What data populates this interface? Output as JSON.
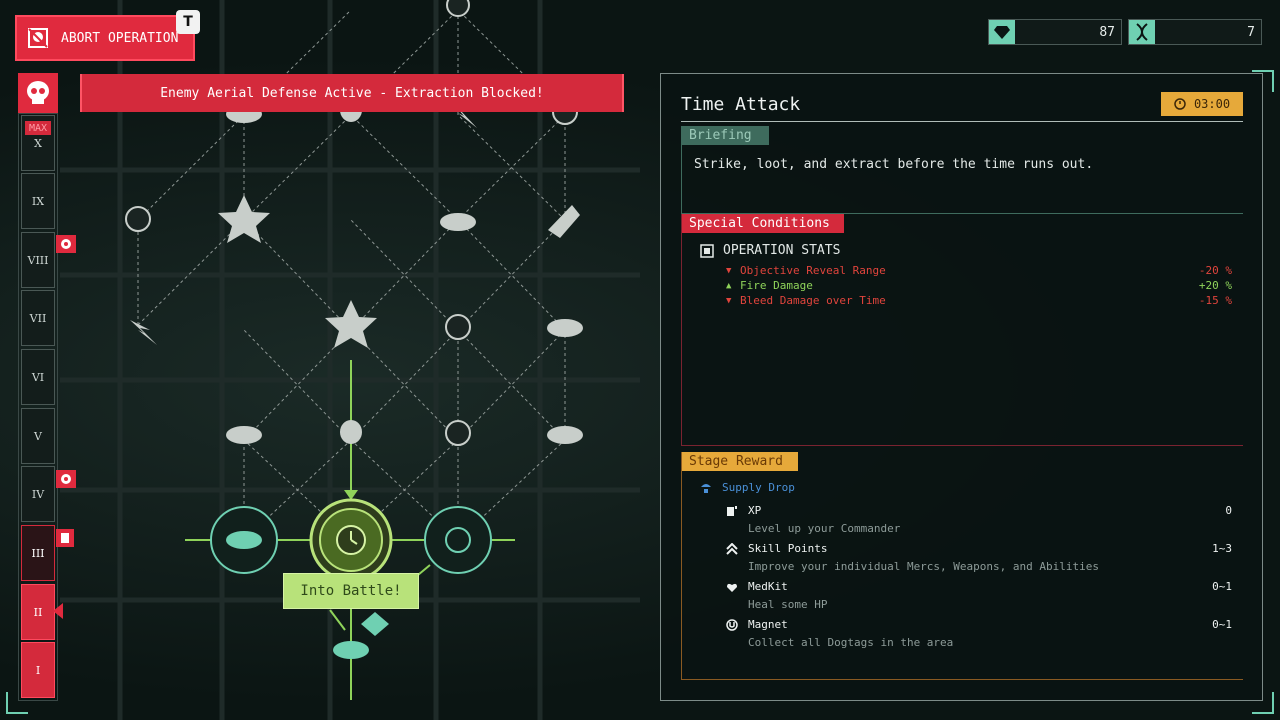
{
  "hud": {
    "abort_label": "ABORT OPERATION",
    "abort_hotkey": "T",
    "gems": "87",
    "dna": "7"
  },
  "banner": "Enemy Aerial Defense Active - Extraction Blocked!",
  "levels": {
    "max_tag": "MAX",
    "labels": [
      "X",
      "IX",
      "VIII",
      "VII",
      "VI",
      "V",
      "IV",
      "III",
      "II",
      "I"
    ],
    "current": "II"
  },
  "map": {
    "into_battle": "Into Battle!"
  },
  "panel": {
    "title": "Time Attack",
    "timer": "03:00",
    "briefing_tag": "Briefing",
    "briefing_text": "Strike, loot, and extract before the time runs out.",
    "special_tag": "Special Conditions",
    "opstats_title": "OPERATION STATS",
    "stats": [
      {
        "dir": "down",
        "label": "Objective Reveal Range",
        "value": "-20 %",
        "color": "#e0443c"
      },
      {
        "dir": "up",
        "label": "Fire Damage",
        "value": "+20 %",
        "color": "#8fd35a"
      },
      {
        "dir": "down",
        "label": "Bleed Damage over Time",
        "value": "-15 %",
        "color": "#e0443c"
      }
    ],
    "reward_tag": "Stage Reward",
    "supply_label": "Supply Drop",
    "rewards": [
      {
        "name": "XP",
        "value": "0",
        "desc": "Level up your Commander",
        "icon": "xp-icon"
      },
      {
        "name": "Skill Points",
        "value": "1~3",
        "desc": "Improve your individual Mercs, Weapons, and Abilities",
        "icon": "skill-points-icon"
      },
      {
        "name": "MedKit",
        "value": "0~1",
        "desc": "Heal some HP",
        "icon": "medkit-icon"
      },
      {
        "name": "Magnet",
        "value": "0~1",
        "desc": "Collect all Dogtags in the area",
        "icon": "magnet-icon"
      }
    ]
  },
  "colors": {
    "danger": "#d42a3c",
    "accent": "#6fd0b2",
    "lime": "#b8e27a",
    "gold": "#e6a93a"
  }
}
